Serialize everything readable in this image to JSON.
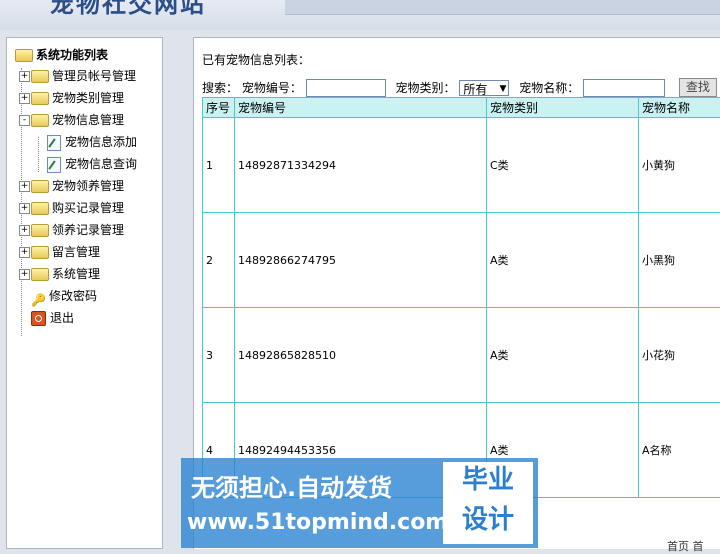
{
  "header": {
    "site_title": "宠物社交网站"
  },
  "sidebar": {
    "root_label": "系统功能列表",
    "items": [
      {
        "label": "管理员帐号管理",
        "icon": "folder-icon",
        "expander": "+"
      },
      {
        "label": "宠物类别管理",
        "icon": "folder-icon",
        "expander": "+"
      },
      {
        "label": "宠物信息管理",
        "icon": "folder-icon",
        "expander": "-"
      },
      {
        "label": "宠物信息添加",
        "icon": "document-icon"
      },
      {
        "label": "宠物信息查询",
        "icon": "document-icon"
      },
      {
        "label": "宠物领养管理",
        "icon": "folder-icon",
        "expander": "+"
      },
      {
        "label": "购买记录管理",
        "icon": "folder-icon",
        "expander": "+"
      },
      {
        "label": "领养记录管理",
        "icon": "folder-icon",
        "expander": "+"
      },
      {
        "label": "留言管理",
        "icon": "folder-icon",
        "expander": "+"
      },
      {
        "label": "系统管理",
        "icon": "folder-icon",
        "expander": "+"
      },
      {
        "label": "修改密码",
        "icon": "key-icon"
      },
      {
        "label": "退出",
        "icon": "exit-icon"
      }
    ]
  },
  "main": {
    "list_title": "已有宠物信息列表：",
    "search": {
      "prefix": "搜索：",
      "pet_no_label": "宠物编号：",
      "category_label": "宠物类别：",
      "category_value": "所有",
      "name_label": "宠物名称：",
      "button_label": "查找"
    },
    "table": {
      "headers": [
        "序号",
        "宠物编号",
        "宠物类别",
        "宠物名称"
      ],
      "rows": [
        [
          "1",
          "14892871334294",
          "C类",
          "小黄狗"
        ],
        [
          "2",
          "14892866274795",
          "A类",
          "小黑狗"
        ],
        [
          "3",
          "14892865828510",
          "A类",
          "小花狗"
        ],
        [
          "4",
          "14892494453356",
          "A类",
          "A名称"
        ]
      ]
    },
    "pager_text": "首页 首"
  },
  "watermark": {
    "line1": "无须担心.自动发货",
    "line2": "www.51topmind.com",
    "box_line1": "毕业",
    "box_line2": "设计"
  },
  "colors": {
    "table_border": "#48c9c9",
    "table_header_bg": "#c9f3f3",
    "title": "#2c4e88"
  }
}
